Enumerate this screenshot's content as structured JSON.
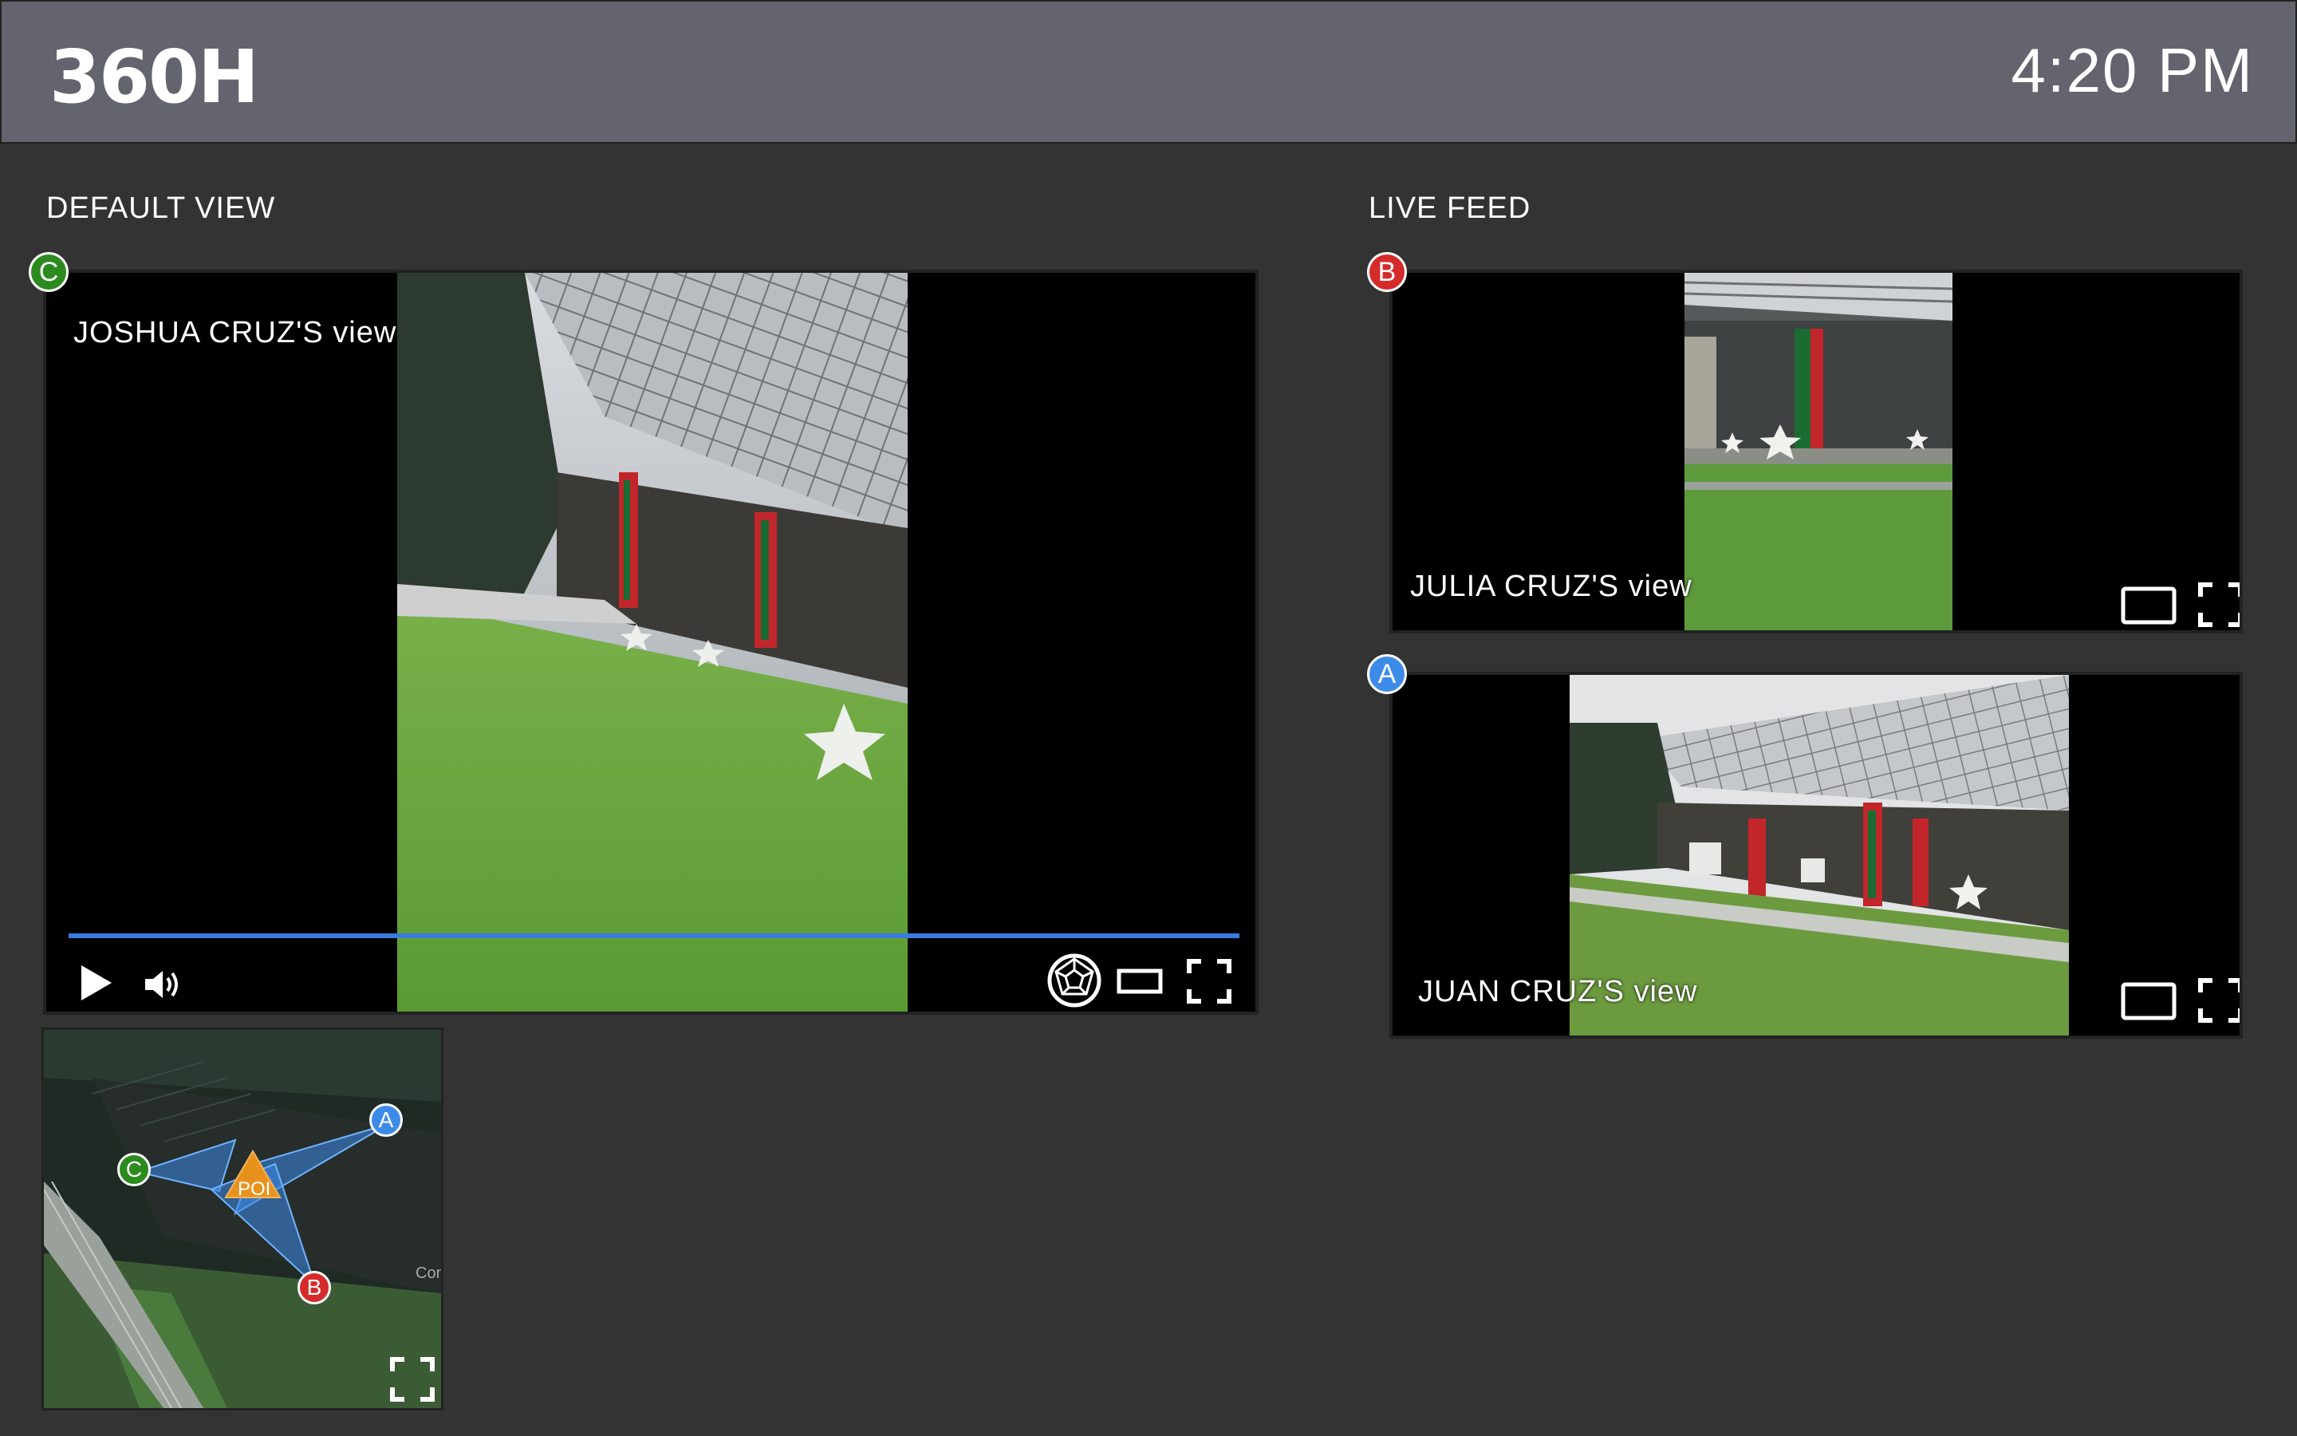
{
  "app": {
    "logo": "360H",
    "time": "4:20 PM"
  },
  "default_view": {
    "section_title": "DEFAULT VIEW",
    "badge": "C",
    "view_label": "JOSHUA CRUZ'S view",
    "progress": 1.0
  },
  "live_feed": {
    "section_title": "LIVE FEED",
    "feeds": [
      {
        "badge": "B",
        "view_label": "JULIA CRUZ'S view"
      },
      {
        "badge": "A",
        "view_label": "JUAN CRUZ'S view"
      }
    ]
  },
  "map": {
    "markers": {
      "a": "A",
      "b": "B",
      "c": "C"
    },
    "poi_label": "POI",
    "map_text": "Con"
  },
  "icons": {
    "play": "play-icon",
    "volume": "volume-icon",
    "vr": "vr-360-icon",
    "theater": "theater-mode-icon",
    "fullscreen": "fullscreen-icon"
  },
  "colors": {
    "header": "#64646f",
    "background": "#333333",
    "progress": "#3a7be0",
    "badge_a": "#3d8be8",
    "badge_b": "#d52b2b",
    "badge_c": "#2c8a1e",
    "poi": "#e8921e"
  }
}
